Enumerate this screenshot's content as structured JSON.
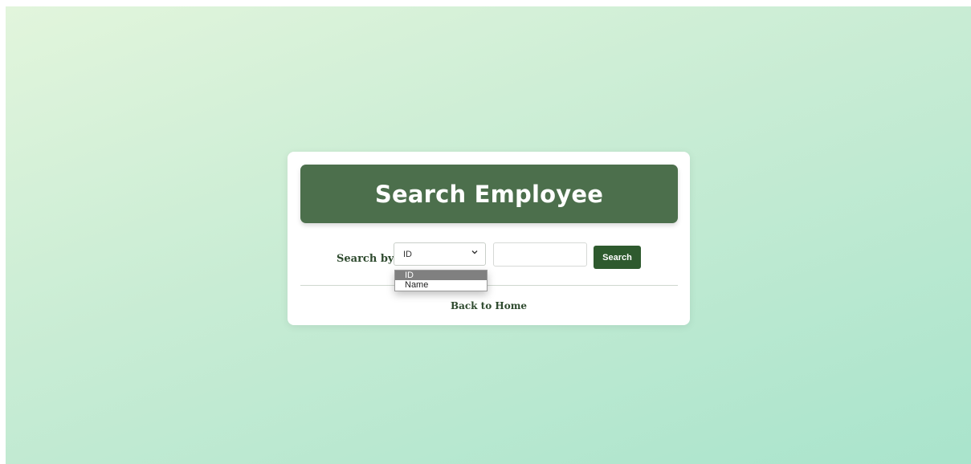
{
  "header": {
    "title": "Search Employee"
  },
  "search": {
    "label": "Search by:",
    "select": {
      "value": "ID",
      "options": [
        "ID",
        "Name"
      ]
    },
    "input": {
      "value": "",
      "placeholder": ""
    },
    "button_label": "Search"
  },
  "footer": {
    "back_link": "Back to Home"
  },
  "colors": {
    "header_bg": "#4c6f4c",
    "button_bg": "#2e5a2e",
    "text_green": "#2e4a2e"
  }
}
